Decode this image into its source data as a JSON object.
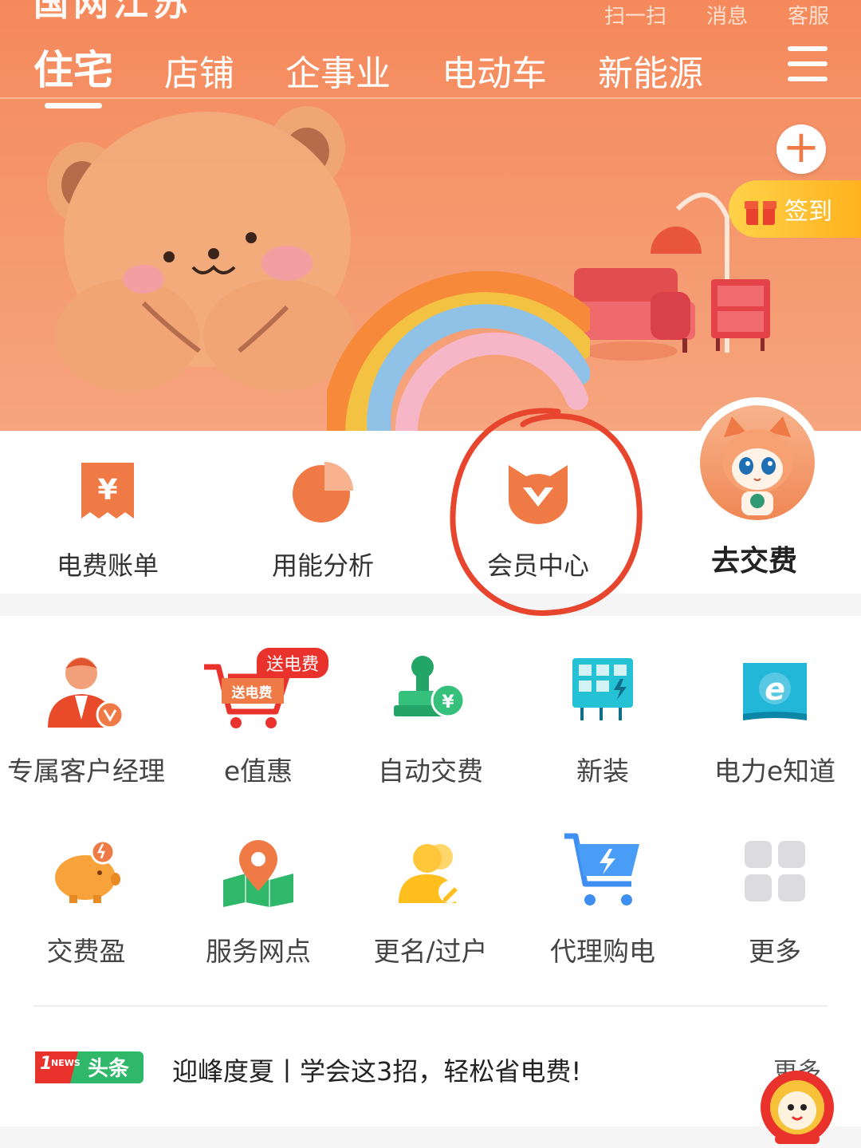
{
  "header": {
    "cut_title": "国网江苏",
    "top_links": [
      "扫一扫",
      "消息",
      "客服"
    ],
    "tabs": [
      "住宅",
      "店铺",
      "企事业",
      "电动车",
      "新能源"
    ],
    "active_tab": 0,
    "signin_label": "签到"
  },
  "quick": {
    "items": [
      {
        "label": "电费账单",
        "icon": "bill-icon"
      },
      {
        "label": "用能分析",
        "icon": "pie-chart-icon"
      },
      {
        "label": "会员中心",
        "icon": "member-cat-icon"
      }
    ],
    "pay_label": "去交费"
  },
  "grid": {
    "items": [
      {
        "label": "专属客户经理",
        "icon": "account-manager-icon"
      },
      {
        "label": "e值惠",
        "icon": "cart-promo-icon",
        "badge": "送电费",
        "cart_text": "送电费"
      },
      {
        "label": "自动交费",
        "icon": "auto-pay-stamp-icon"
      },
      {
        "label": "新装",
        "icon": "new-install-icon"
      },
      {
        "label": "电力e知道",
        "icon": "e-book-icon"
      },
      {
        "label": "交费盈",
        "icon": "piggy-bank-icon"
      },
      {
        "label": "服务网点",
        "icon": "map-pin-icon"
      },
      {
        "label": "更名/过户",
        "icon": "user-rename-icon"
      },
      {
        "label": "代理购电",
        "icon": "power-cart-icon"
      },
      {
        "label": "更多",
        "icon": "more-grid-icon"
      }
    ]
  },
  "news": {
    "badge_small": "NEWS",
    "badge_label": "头条",
    "headline": "迎峰度夏丨学会这3招，轻松省电费!",
    "more": "更多"
  },
  "colors": {
    "header_orange": "#f5895b",
    "accent_orange": "#f07a45",
    "signin_yellow": "#ffc133",
    "badge_red": "#e8322b",
    "green": "#2fb86a",
    "blue": "#3f8ff2"
  }
}
